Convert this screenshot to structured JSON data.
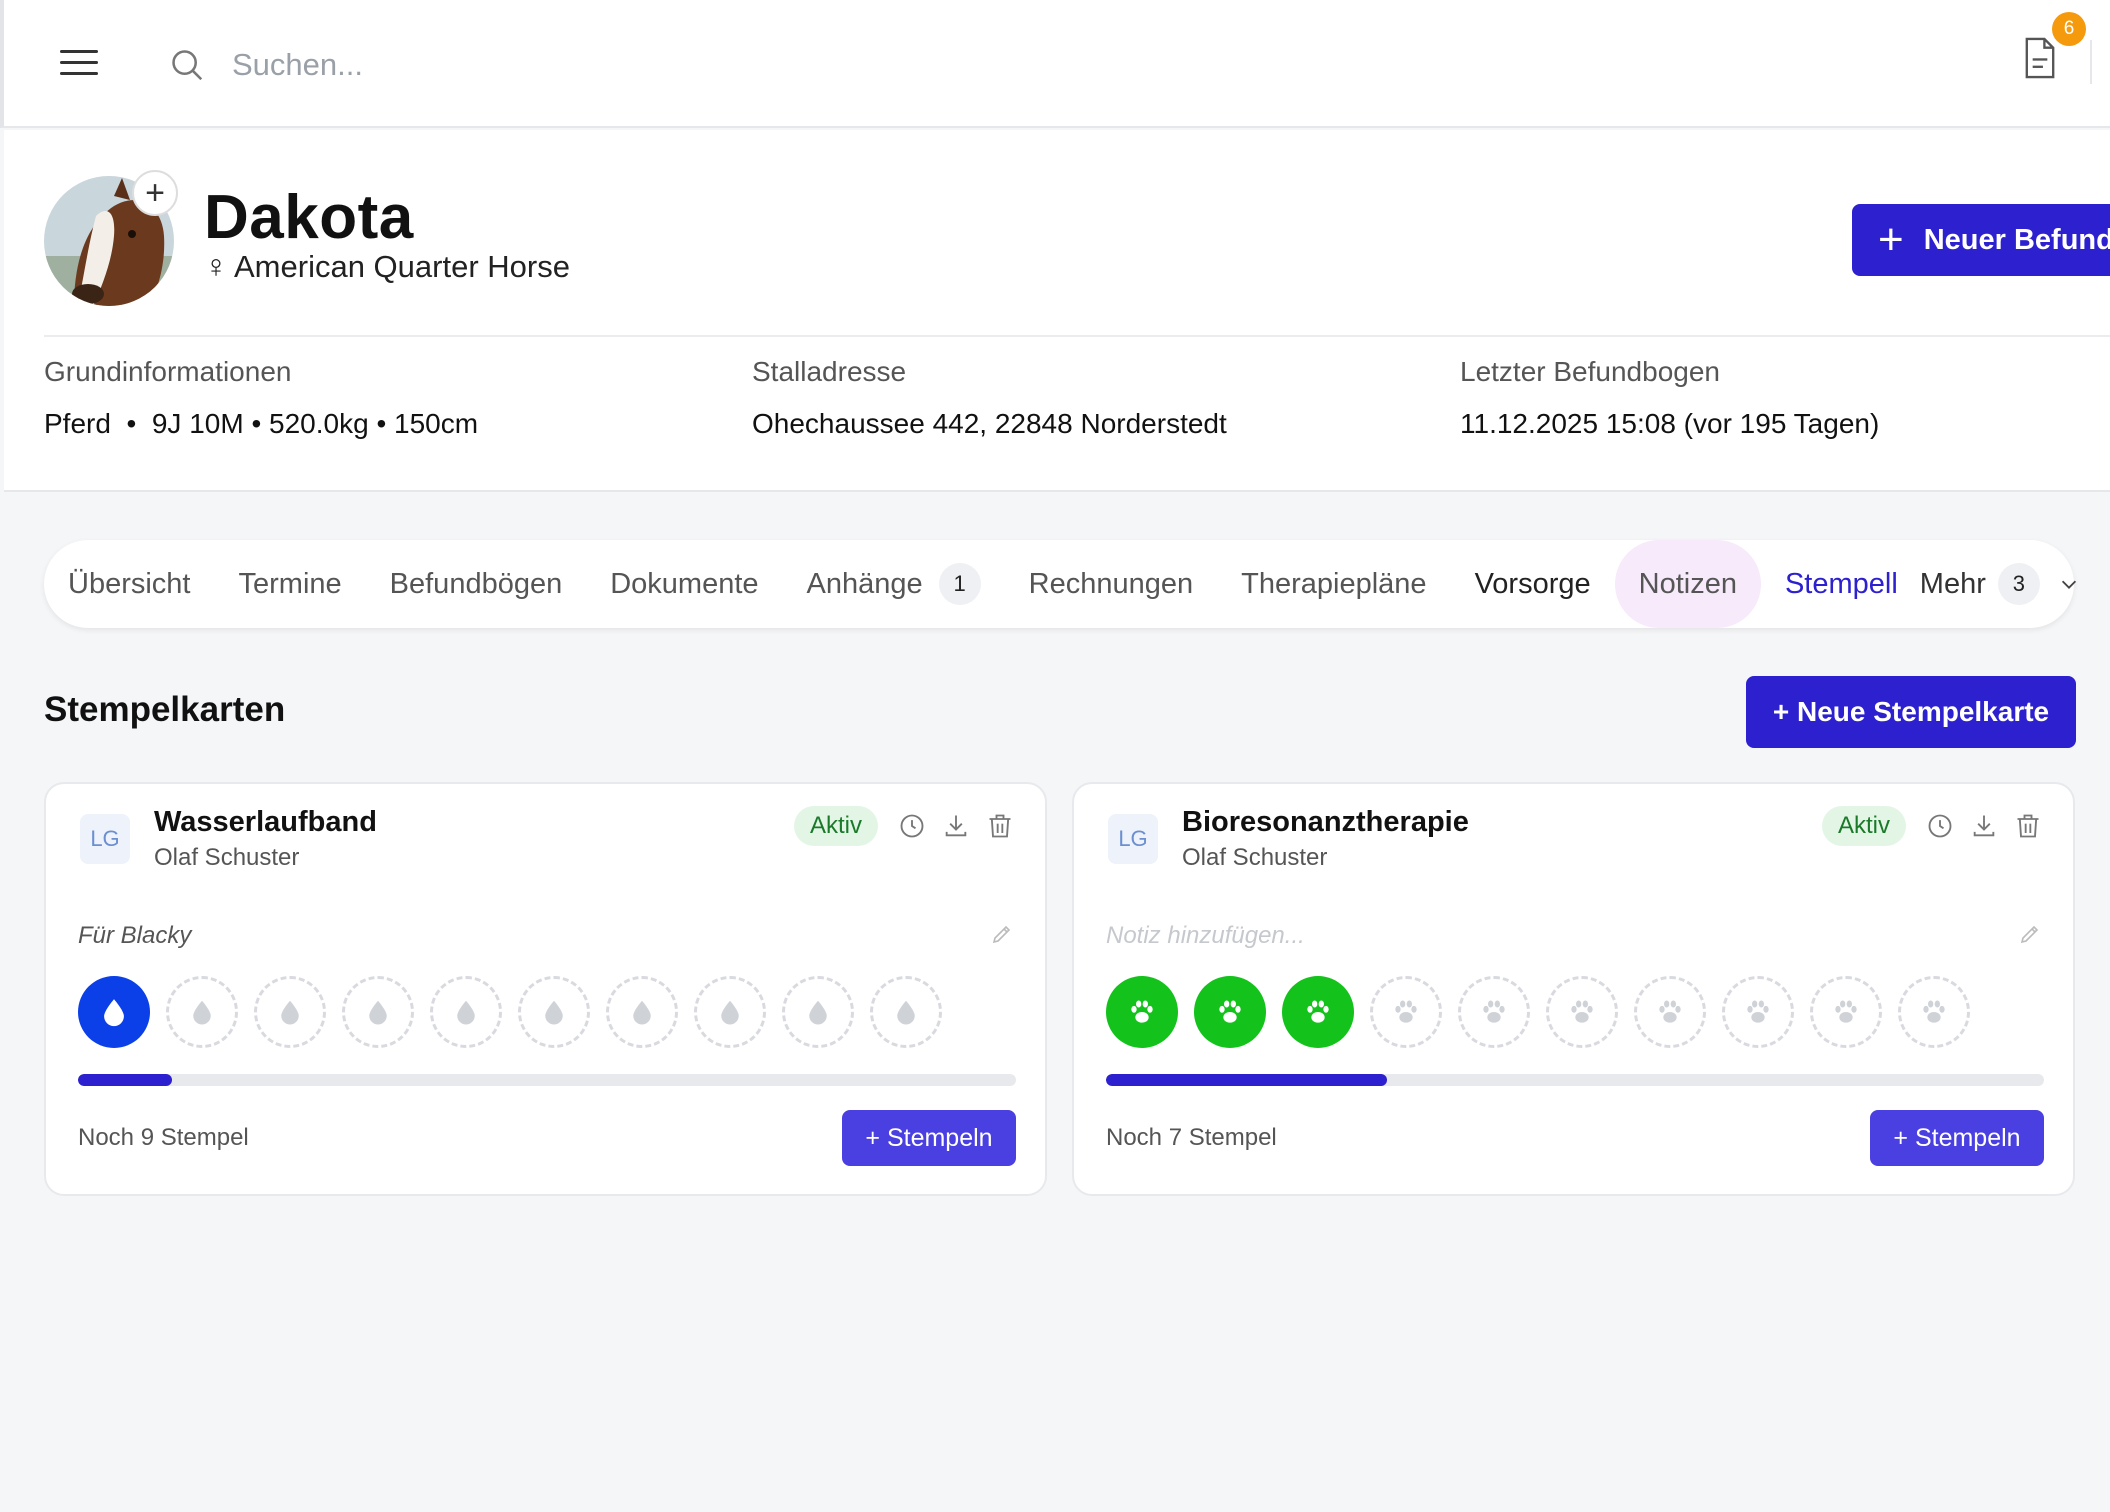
{
  "topbar": {
    "search_placeholder": "Suchen...",
    "notification_count": "6"
  },
  "patient": {
    "name": "Dakota",
    "sex_symbol": "♀",
    "breed": "American Quarter Horse",
    "new_befund_label": "Neuer Befund"
  },
  "info": {
    "basic_label": "Grundinformationen",
    "basic_value": "Pferd  •  9J 10M • 520.0kg • 150cm",
    "address_label": "Stalladresse",
    "address_value": "Ohechaussee 442, 22848 Norderstedt",
    "last_label": "Letzter Befundbogen",
    "last_value": "11.12.2025 15:08 (vor 195 Tagen)"
  },
  "tabs": [
    {
      "label": "Übersicht"
    },
    {
      "label": "Termine"
    },
    {
      "label": "Befundbögen"
    },
    {
      "label": "Dokumente"
    },
    {
      "label": "Anhänge",
      "count": "1"
    },
    {
      "label": "Rechnungen"
    },
    {
      "label": "Therapiepläne"
    },
    {
      "label": "Vorsorge"
    },
    {
      "label": "Notizen"
    },
    {
      "label": "Stempell"
    },
    {
      "label": "Mehr",
      "count": "3"
    }
  ],
  "section": {
    "title": "Stempelkarten",
    "new_card_label": "+ Neue Stempelkarte"
  },
  "cards": [
    {
      "initials": "LG",
      "title": "Wasserlaufband",
      "subtitle": "Olaf Schuster",
      "status": "Aktiv",
      "note": "Für Blacky",
      "stamp_icon": "water-drop-icon",
      "stamps_filled": 1,
      "stamps_total": 10,
      "fill_color": "#0b3fe8",
      "progress": 0.1,
      "remaining": "Noch 9 Stempel",
      "stamp_button": "+ Stempeln"
    },
    {
      "initials": "LG",
      "title": "Bioresonanztherapie",
      "subtitle": "Olaf Schuster",
      "status": "Aktiv",
      "note_placeholder": "Notiz hinzufügen...",
      "stamp_icon": "paw-icon",
      "stamps_filled": 3,
      "stamps_total": 10,
      "fill_color": "#13c21a",
      "progress": 0.3,
      "remaining": "Noch 7 Stempel",
      "stamp_button": "+ Stempeln"
    }
  ],
  "colors": {
    "primary": "#2c20cf",
    "active_badge_bg": "#e3f6e6",
    "notification": "#f59a0c"
  }
}
